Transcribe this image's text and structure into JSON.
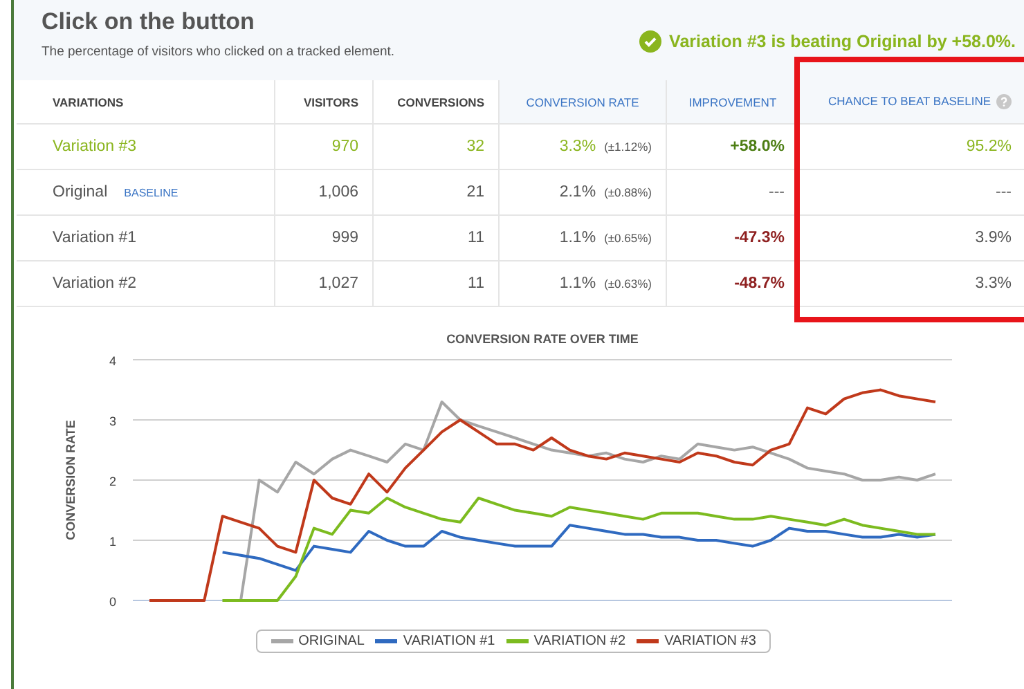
{
  "header": {
    "title": "Click on the button",
    "subtitle": "The percentage of visitors who clicked on a tracked element.",
    "result": "Variation #3 is beating Original by +58.0%."
  },
  "table": {
    "columns": [
      {
        "label": "VARIATIONS",
        "kind": "count",
        "highlighted": false
      },
      {
        "label": "VISITORS",
        "kind": "count",
        "highlighted": false
      },
      {
        "label": "CONVERSIONS",
        "kind": "count",
        "highlighted": false
      },
      {
        "label": "CONVERSION RATE",
        "kind": "stat",
        "highlighted": false
      },
      {
        "label": "IMPROVEMENT",
        "kind": "stat",
        "highlighted": false
      },
      {
        "label": "CHANCE TO BEAT BASELINE",
        "kind": "stat",
        "highlighted": true,
        "help": true
      }
    ],
    "rows": [
      {
        "name": "Variation #3",
        "kind": "winner",
        "visitors": "970",
        "conversions": "32",
        "rate": "3.3%",
        "margin": "(±1.12%)",
        "improvement": "+58.0%",
        "chance": "95.2%"
      },
      {
        "name": "Original",
        "badge": "BASELINE",
        "kind": "baseline",
        "visitors": "1,006",
        "conversions": "21",
        "rate": "2.1%",
        "margin": "(±0.88%)",
        "improvement": "---",
        "chance": "---"
      },
      {
        "name": "Variation #1",
        "kind": "loser",
        "visitors": "999",
        "conversions": "11",
        "rate": "1.1%",
        "margin": "(±0.65%)",
        "improvement": "-47.3%",
        "chance": "3.9%"
      },
      {
        "name": "Variation #2",
        "kind": "loser",
        "visitors": "1,027",
        "conversions": "11",
        "rate": "1.1%",
        "margin": "(±0.63%)",
        "improvement": "-48.7%",
        "chance": "3.3%"
      }
    ]
  },
  "chart": {
    "chart_data": {
      "type": "line",
      "title": "CONVERSION RATE OVER TIME",
      "ylabel": "CONVERSION RATE",
      "ylim": [
        0,
        4
      ],
      "yticks": [
        0,
        1,
        2,
        3,
        4
      ],
      "grid": true,
      "legend": true,
      "series": [
        {
          "name": "ORIGINAL",
          "color": "#a6a6a6",
          "values": [
            null,
            null,
            null,
            null,
            0,
            0,
            2.0,
            1.8,
            2.3,
            2.1,
            2.35,
            2.5,
            2.4,
            2.3,
            2.6,
            2.5,
            3.3,
            3.0,
            2.9,
            2.8,
            2.7,
            2.6,
            2.5,
            2.45,
            2.4,
            2.45,
            2.35,
            2.3,
            2.4,
            2.35,
            2.6,
            2.55,
            2.5,
            2.55,
            2.45,
            2.35,
            2.2,
            2.15,
            2.1,
            2.0,
            2.0,
            2.05,
            2.0,
            2.1
          ]
        },
        {
          "name": "VARIATION #1",
          "color": "#2f6ac0",
          "values": [
            null,
            null,
            null,
            null,
            0.8,
            0.75,
            0.7,
            0.6,
            0.5,
            0.9,
            0.85,
            0.8,
            1.15,
            1.0,
            0.9,
            0.9,
            1.15,
            1.05,
            1.0,
            0.95,
            0.9,
            0.9,
            0.9,
            1.25,
            1.2,
            1.15,
            1.1,
            1.1,
            1.05,
            1.05,
            1.0,
            1.0,
            0.95,
            0.9,
            1.0,
            1.2,
            1.15,
            1.15,
            1.1,
            1.05,
            1.05,
            1.1,
            1.05,
            1.1
          ]
        },
        {
          "name": "VARIATION #2",
          "color": "#7cbb1f",
          "values": [
            null,
            null,
            null,
            null,
            0,
            0,
            0,
            0,
            0.4,
            1.2,
            1.1,
            1.5,
            1.45,
            1.7,
            1.55,
            1.45,
            1.35,
            1.3,
            1.7,
            1.6,
            1.5,
            1.45,
            1.4,
            1.55,
            1.5,
            1.45,
            1.4,
            1.35,
            1.45,
            1.45,
            1.45,
            1.4,
            1.35,
            1.35,
            1.4,
            1.35,
            1.3,
            1.25,
            1.35,
            1.25,
            1.2,
            1.15,
            1.1,
            1.1
          ]
        },
        {
          "name": "VARIATION #3",
          "color": "#c0391b",
          "values": [
            0,
            0,
            0,
            0,
            1.4,
            1.3,
            1.2,
            0.9,
            0.8,
            2.0,
            1.7,
            1.6,
            2.1,
            1.8,
            2.2,
            2.5,
            2.8,
            3.0,
            2.8,
            2.6,
            2.6,
            2.5,
            2.7,
            2.5,
            2.4,
            2.35,
            2.45,
            2.4,
            2.35,
            2.3,
            2.45,
            2.4,
            2.3,
            2.25,
            2.5,
            2.6,
            3.2,
            3.1,
            3.35,
            3.45,
            3.5,
            3.4,
            3.35,
            3.3
          ]
        }
      ]
    }
  }
}
